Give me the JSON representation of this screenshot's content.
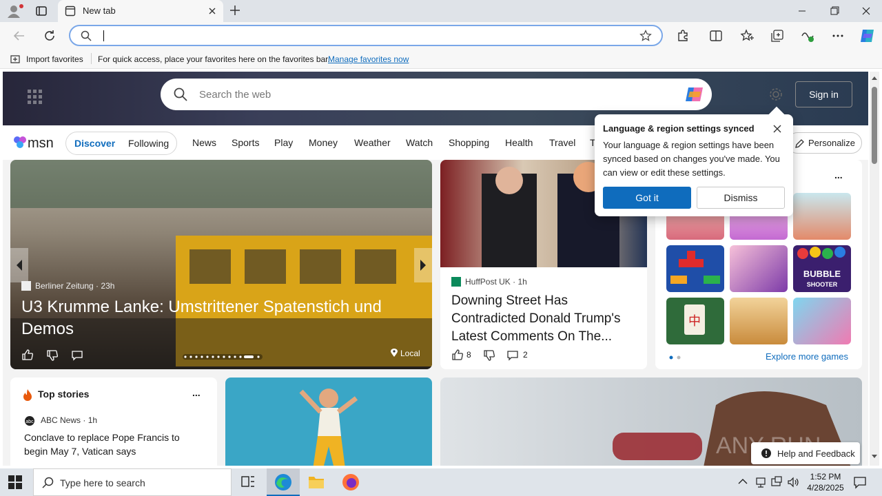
{
  "browser": {
    "tab_title": "New tab",
    "favorites_bar": {
      "import_label": "Import favorites",
      "hint": "For quick access, place your favorites here on the favorites bar.",
      "manage_link": "Manage favorites now"
    }
  },
  "msn": {
    "search_placeholder": "Search the web",
    "sign_in": "Sign in",
    "logo_text": "msn",
    "pills": {
      "discover": "Discover",
      "following": "Following"
    },
    "nav_items": [
      "News",
      "Sports",
      "Play",
      "Money",
      "Weather",
      "Watch",
      "Shopping",
      "Health",
      "Travel",
      "T"
    ],
    "personalize": "Personalize",
    "hero": {
      "source": "Berliner Zeitung",
      "time": "23h",
      "title": "U3 Krumme Lanke: Umstrittener Spatenstich und Demos",
      "local_label": "Local"
    },
    "news_card": {
      "source": "HuffPost UK",
      "time": "1h",
      "title": "Downing Street Has Contradicted Donald Trump's Latest Comments On The...",
      "likes": "8",
      "comments": "2"
    },
    "games": {
      "explore_label": "Explore more games",
      "more_label": "..."
    },
    "top_stories": {
      "header": "Top stories",
      "source": "ABC News",
      "time": "1h",
      "story": "Conclave to replace Pope Francis to begin May 7, Vatican says",
      "more_label": "..."
    },
    "feedback_label": "Help and Feedback",
    "watermark": "ANY RUN"
  },
  "popup": {
    "title": "Language & region settings synced",
    "body": "Your language & region settings have been synced based on changes you've made. You can view or edit these settings.",
    "got_it": "Got it",
    "dismiss": "Dismiss"
  },
  "taskbar": {
    "search_placeholder": "Type here to search",
    "time": "1:52 PM",
    "date": "4/28/2025"
  },
  "colors": {
    "accent": "#0f6cbd",
    "tabbar": "#dfe3e8",
    "taskbar": "#dfe4ea"
  }
}
